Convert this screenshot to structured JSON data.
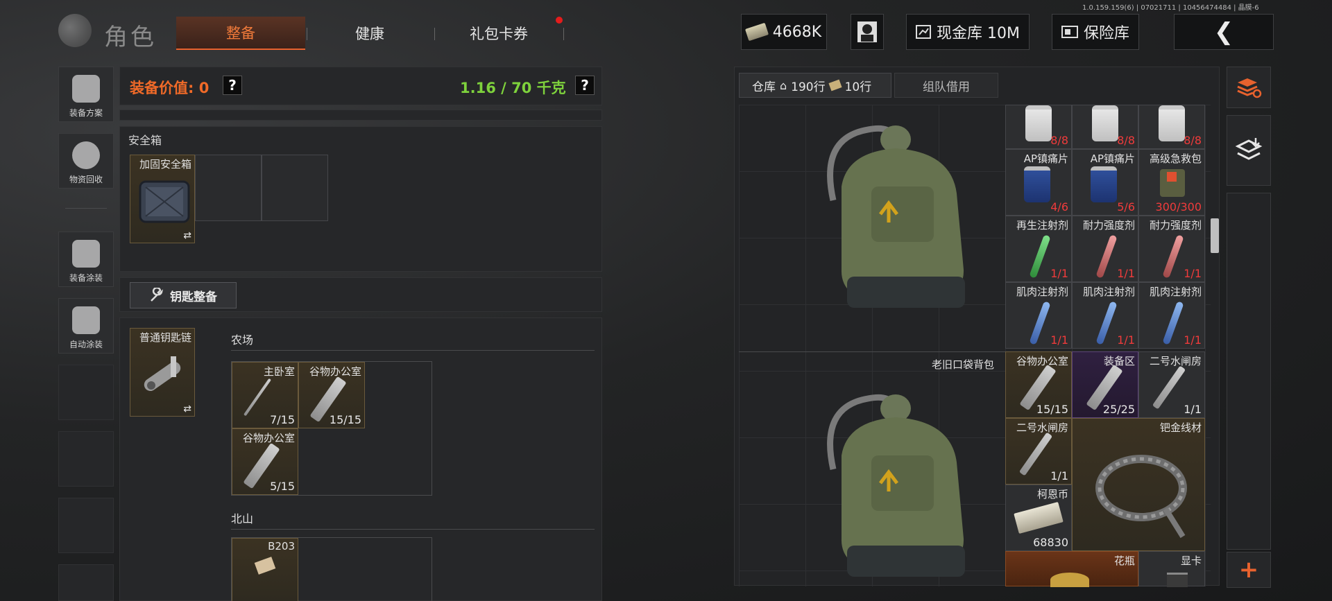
{
  "version": "1.0.159.159(6) | 07021711 | 10456474484 | 晶膜-6",
  "header": {
    "title": "角色",
    "tabs": [
      {
        "label": "整备",
        "active": true
      },
      {
        "label": "健康",
        "active": false
      },
      {
        "label": "礼包卡券",
        "active": false,
        "notification": true
      }
    ],
    "currency": "4668K",
    "cash_vault": "现金库 10M",
    "safe_vault": "保险库",
    "back": "❮"
  },
  "sidebar": {
    "items": [
      {
        "label": "装备方案",
        "icon": "helmet-grid-icon"
      },
      {
        "label": "物资回收",
        "icon": "recycle-face-icon"
      },
      {
        "label": "装备涂装",
        "icon": "helmet-paint-icon"
      },
      {
        "label": "自动涂装",
        "icon": "brush-gear-icon"
      }
    ]
  },
  "equipment": {
    "value_label": "装备价值: 0",
    "weight": "1.16 / 70 千克",
    "help": "?",
    "secure_case": {
      "label": "安全箱",
      "item": "加固安全箱",
      "swap": "⇄"
    },
    "key_button": "钥匙整备",
    "keychain": {
      "item": "普通钥匙链",
      "swap": "⇄",
      "groups": [
        {
          "name": "农场",
          "keys": [
            {
              "name": "主卧室",
              "count": "7/15"
            },
            {
              "name": "谷物办公室",
              "count": "15/15"
            },
            {
              "name": "谷物办公室",
              "count": "5/15"
            }
          ]
        },
        {
          "name": "北山",
          "keys": [
            {
              "name": "B203",
              "count": ""
            }
          ]
        }
      ]
    }
  },
  "warehouse": {
    "tab_label": "仓库",
    "houses": "190行",
    "tickets": "10行",
    "team_tab": "组队借用",
    "backpack_name": "老旧口袋背包",
    "items": [
      {
        "name": "",
        "count": "8/8"
      },
      {
        "name": "",
        "count": "8/8"
      },
      {
        "name": "",
        "count": "8/8"
      },
      {
        "name": "AP镇痛片",
        "count": "4/6"
      },
      {
        "name": "AP镇痛片",
        "count": "5/6"
      },
      {
        "name": "高级急救包",
        "count": "300/300"
      },
      {
        "name": "再生注射剂",
        "count": "1/1"
      },
      {
        "name": "耐力强度剂",
        "count": "1/1"
      },
      {
        "name": "耐力强度剂",
        "count": "1/1"
      },
      {
        "name": "肌肉注射剂",
        "count": "1/1"
      },
      {
        "name": "肌肉注射剂",
        "count": "1/1"
      },
      {
        "name": "肌肉注射剂",
        "count": "1/1"
      },
      {
        "name": "谷物办公室",
        "count": "15/15"
      },
      {
        "name": "装备区",
        "count": "25/25"
      },
      {
        "name": "二号水闸房",
        "count": "1/1"
      },
      {
        "name": "二号水闸房",
        "count": "1/1"
      },
      {
        "name": "钯金线材",
        "count": ""
      },
      {
        "name": "柯恩币",
        "count": "68830"
      },
      {
        "name": "花瓶",
        "count": ""
      },
      {
        "name": "显卡",
        "count": ""
      }
    ]
  },
  "right_tools": {
    "add": "+"
  },
  "colors": {
    "accent": "#f07a3a",
    "weight_green": "#7ed23c",
    "red_count": "#f03b3b",
    "value_orange": "#f06a28"
  }
}
